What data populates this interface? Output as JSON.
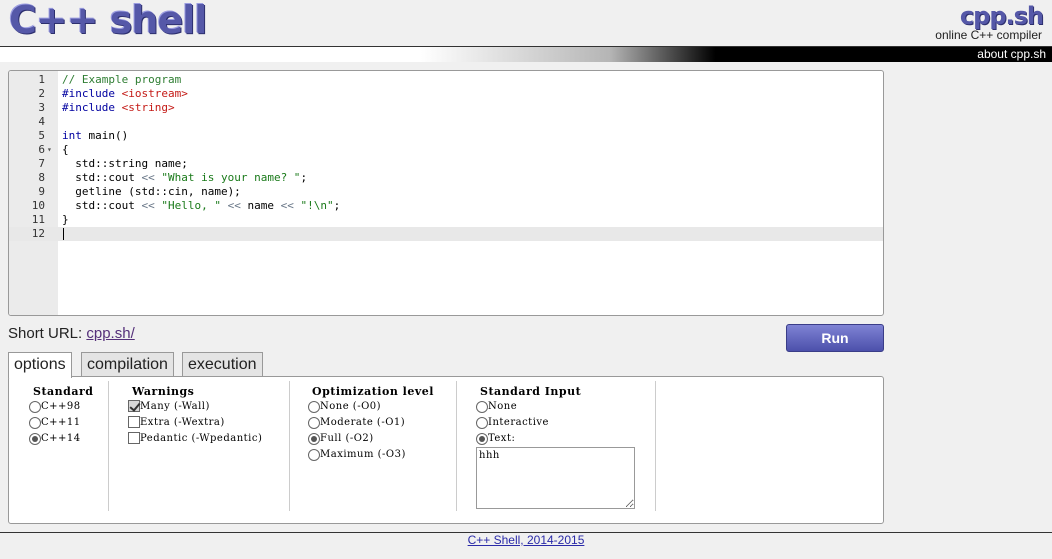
{
  "header": {
    "logo": "C++ shell",
    "brand": "cpp.sh",
    "tagline": "online C++ compiler",
    "about_link": "about cpp.sh"
  },
  "editor": {
    "lines": [
      {
        "num": "1",
        "text": "// Example program"
      },
      {
        "num": "2",
        "text": "#include <iostream>"
      },
      {
        "num": "3",
        "text": "#include <string>"
      },
      {
        "num": "4",
        "text": ""
      },
      {
        "num": "5",
        "text": "int main()"
      },
      {
        "num": "6",
        "text": "{",
        "fold": "▾"
      },
      {
        "num": "7",
        "text": "  std::string name;"
      },
      {
        "num": "8",
        "text": "  std::cout << \"What is your name? \";"
      },
      {
        "num": "9",
        "text": "  getline (std::cin, name);"
      },
      {
        "num": "10",
        "text": "  std::cout << \"Hello, \" << name << \"!\\n\";"
      },
      {
        "num": "11",
        "text": "}"
      },
      {
        "num": "12",
        "text": ""
      }
    ],
    "active_line": "12"
  },
  "short_url": {
    "label": "Short URL: ",
    "link": "cpp.sh/"
  },
  "run_button": "Run",
  "tabs": [
    "options",
    "compilation",
    "execution"
  ],
  "active_tab": "options",
  "options": {
    "standard": {
      "title": "Standard",
      "items": [
        {
          "label": "C++98",
          "checked": false
        },
        {
          "label": "C++11",
          "checked": false
        },
        {
          "label": "C++14",
          "checked": true
        }
      ]
    },
    "warnings": {
      "title": "Warnings",
      "items": [
        {
          "label": "Many (-Wall)",
          "checked": true
        },
        {
          "label": "Extra (-Wextra)",
          "checked": false
        },
        {
          "label": "Pedantic (-Wpedantic)",
          "checked": false
        }
      ]
    },
    "optimization": {
      "title": "Optimization level",
      "items": [
        {
          "label": "None (-O0)",
          "checked": false
        },
        {
          "label": "Moderate (-O1)",
          "checked": false
        },
        {
          "label": "Full (-O2)",
          "checked": true
        },
        {
          "label": "Maximum (-O3)",
          "checked": false
        }
      ]
    },
    "stdin": {
      "title": "Standard Input",
      "items": [
        {
          "label": "None",
          "checked": false
        },
        {
          "label": "Interactive",
          "checked": false
        },
        {
          "label": "Text:",
          "checked": true
        }
      ],
      "text_value": "hhh"
    }
  },
  "footer": "C++ Shell, 2014-2015",
  "colors": {
    "brand": "#5558a8",
    "run_button": "#5b5fb8",
    "comment": "#2e7d32",
    "preprocessor": "#0000a0",
    "include_string": "#c41a16",
    "string_literal": "#1a7a1a"
  }
}
